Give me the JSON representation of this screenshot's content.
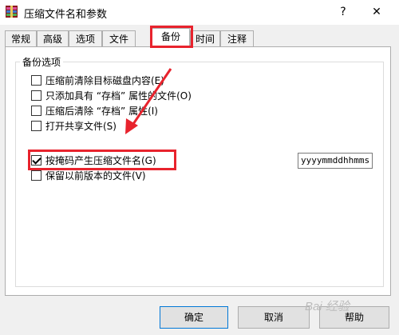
{
  "window": {
    "title": "压缩文件名和参数",
    "help_label": "?",
    "close_label": "✕"
  },
  "tabs": [
    {
      "label": "常规"
    },
    {
      "label": "高级"
    },
    {
      "label": "选项"
    },
    {
      "label": "文件"
    },
    {
      "label": "备份",
      "active": true
    },
    {
      "label": "时间"
    },
    {
      "label": "注释"
    }
  ],
  "group": {
    "label": "备份选项",
    "options": [
      {
        "label": "压缩前清除目标磁盘内容(E)",
        "checked": false
      },
      {
        "label": "只添加具有 “存档” 属性的文件(O)",
        "checked": false
      },
      {
        "label": "压缩后清除 “存档” 属性(I)",
        "checked": false
      },
      {
        "label": "打开共享文件(S)",
        "checked": false
      },
      {
        "label": "按掩码产生压缩文件名(G)",
        "checked": true
      },
      {
        "label": "保留以前版本的文件(V)",
        "checked": false
      }
    ],
    "mask_value": "yyyymmddhhmms"
  },
  "buttons": {
    "ok": "确定",
    "cancel": "取消",
    "help": "帮助"
  },
  "watermark": "Bai 经验",
  "colors": {
    "highlight": "#e8232d",
    "dialog_bg": "#f0f0f0"
  }
}
